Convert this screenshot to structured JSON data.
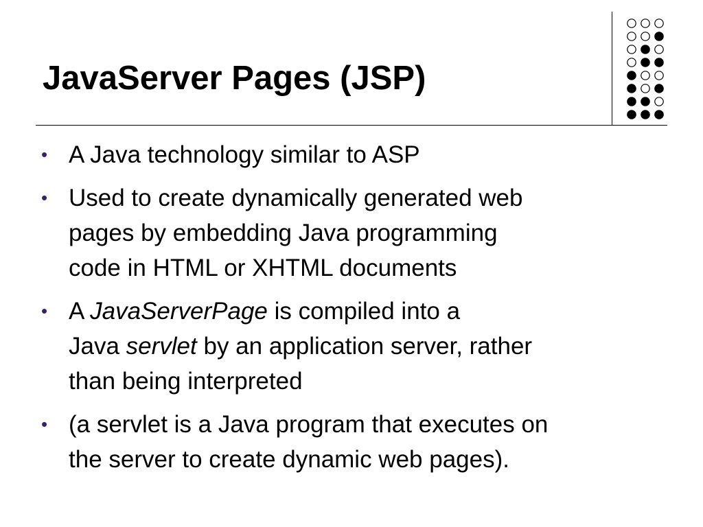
{
  "slide": {
    "title": "JavaServer Pages (JSP)",
    "bullet_glyph": "•",
    "bullet_color": "#3a1f6e",
    "decoration": {
      "icon": "dot-grid-icon",
      "dot_pattern": [
        [
          "open",
          "open",
          "open"
        ],
        [
          "open",
          "open",
          "filled"
        ],
        [
          "open",
          "filled",
          "open"
        ],
        [
          "open",
          "filled",
          "filled"
        ],
        [
          "filled",
          "open",
          "open"
        ],
        [
          "filled",
          "open",
          "filled"
        ],
        [
          "filled",
          "filled",
          "open"
        ],
        [
          "filled",
          "filled",
          "filled"
        ]
      ]
    },
    "bullets": [
      {
        "lines": [
          {
            "text": "A Java technology similar to ASP"
          }
        ]
      },
      {
        "lines": [
          {
            "text": "Used to create dynamically generated web"
          },
          {
            "text": "pages by embedding Java programming"
          },
          {
            "text": "code in HTML or XHTML documents"
          }
        ]
      },
      {
        "lines": [
          {
            "pre": "A ",
            "em": "JavaServerPage",
            "post": " is compiled into a"
          },
          {
            "pre": "Java ",
            "em": "servlet",
            "post": " by an application server, rather"
          },
          {
            "text": "than being interpreted"
          }
        ]
      },
      {
        "lines": [
          {
            "text": "(a servlet is a Java program that executes on"
          },
          {
            "text": "the server to create dynamic web pages)."
          }
        ]
      }
    ]
  }
}
